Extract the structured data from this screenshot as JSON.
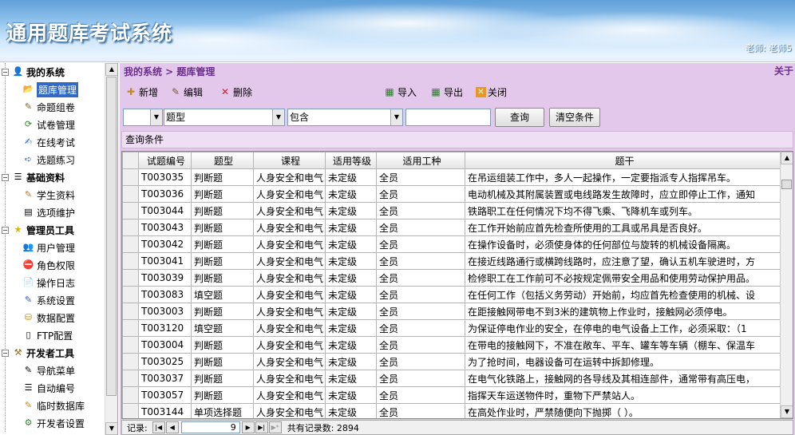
{
  "app": {
    "title": "通用题库考试系统",
    "user_text": "老师: 老师5"
  },
  "sidebar": {
    "groups": [
      {
        "label": "我的系统",
        "items": [
          {
            "label": "题库管理",
            "icon": "folder-open-icon"
          },
          {
            "label": "命题组卷",
            "icon": "pen-icon"
          },
          {
            "label": "试卷管理",
            "icon": "document-refresh-icon"
          },
          {
            "label": "在线考试",
            "icon": "exam-icon"
          },
          {
            "label": "选题练习",
            "icon": "practice-icon"
          }
        ]
      },
      {
        "label": "基础资料",
        "items": [
          {
            "label": "学生资料",
            "icon": "student-icon"
          },
          {
            "label": "选项维护",
            "icon": "list-icon"
          }
        ]
      },
      {
        "label": "管理员工具",
        "items": [
          {
            "label": "用户管理",
            "icon": "users-icon"
          },
          {
            "label": "角色权限",
            "icon": "forbidden-icon"
          },
          {
            "label": "操作日志",
            "icon": "log-icon"
          },
          {
            "label": "系统设置",
            "icon": "settings-icon"
          },
          {
            "label": "数据配置",
            "icon": "database-icon"
          },
          {
            "label": "FTP配置",
            "icon": "ftp-icon"
          }
        ]
      },
      {
        "label": "开发者工具",
        "items": [
          {
            "label": "导航菜单",
            "icon": "menu-icon"
          },
          {
            "label": "自动编号",
            "icon": "numbering-icon"
          },
          {
            "label": "临时数据库",
            "icon": "temp-db-icon"
          },
          {
            "label": "开发者设置",
            "icon": "dev-settings-icon"
          }
        ]
      }
    ],
    "selected": "题库管理"
  },
  "main": {
    "breadcrumb": "我的系统 > 题库管理",
    "about_label": "关于",
    "toolbar": {
      "add": "新增",
      "edit": "编辑",
      "delete": "删除",
      "import": "导入",
      "export": "导出",
      "close": "关闭"
    },
    "filter": {
      "field1_value": "",
      "field2_value": "题型",
      "operator_value": "包含",
      "keyword_value": "",
      "query_button": "查询",
      "clear_button": "清空条件"
    },
    "query_conditions_label": "查询条件",
    "grid": {
      "columns": [
        "试题编号",
        "题型",
        "课程",
        "适用等级",
        "适用工种",
        "题干"
      ],
      "rows": [
        [
          "T003035",
          "判断题",
          "人身安全和电气",
          "未定级",
          "全员",
          "在吊运组装工作中，多人一起操作，一定要指派专人指挥吊车。"
        ],
        [
          "T003036",
          "判断题",
          "人身安全和电气",
          "未定级",
          "全员",
          "电动机械及其附属装置或电线路发生故障时，应立即停止工作，通知"
        ],
        [
          "T003044",
          "判断题",
          "人身安全和电气",
          "未定级",
          "全员",
          "铁路职工在任何情况下均不得飞乘、飞降机车或列车。"
        ],
        [
          "T003043",
          "判断题",
          "人身安全和电气",
          "未定级",
          "全员",
          "在工作开始前应首先检查所使用的工具或吊具是否良好。"
        ],
        [
          "T003042",
          "判断题",
          "人身安全和电气",
          "未定级",
          "全员",
          "在操作设备时，必须使身体的任何部位与旋转的机械设备隔离。"
        ],
        [
          "T003041",
          "判断题",
          "人身安全和电气",
          "未定级",
          "全员",
          "在接近线路通行或横跨线路时，应注意了望，确认五机车驶进时，方"
        ],
        [
          "T003039",
          "判断题",
          "人身安全和电气",
          "未定级",
          "全员",
          "检修职工在工作前可不必按规定佩带安全用品和使用劳动保护用品。"
        ],
        [
          "T003083",
          "填空题",
          "人身安全和电气",
          "未定级",
          "全员",
          "在任何工作（包括义务劳动）开始前，均应首先检查使用的机械、设"
        ],
        [
          "T003003",
          "判断题",
          "人身安全和电气",
          "未定级",
          "全员",
          "在距接触网带电不到3米的建筑物上作业时，接触网必须停电。"
        ],
        [
          "T003120",
          "填空题",
          "人身安全和电气",
          "未定级",
          "全员",
          "为保证停电作业的安全，在停电的电气设备上工作，必须采取：（1"
        ],
        [
          "T003004",
          "判断题",
          "人身安全和电气",
          "未定级",
          "全员",
          "在带电的接触网下，不准在敞车、平车、罐车等车辆（棚车、保温车"
        ],
        [
          "T003025",
          "判断题",
          "人身安全和电气",
          "未定级",
          "全员",
          "为了抢时间，电器设备可在运转中拆卸修理。"
        ],
        [
          "T003037",
          "判断题",
          "人身安全和电气",
          "未定级",
          "全员",
          "在电气化铁路上，接触网的各导线及其相连部件，通常带有高压电，"
        ],
        [
          "T003057",
          "判断题",
          "人身安全和电气",
          "未定级",
          "全员",
          "指挥天车运送物件时，重物下严禁站人。"
        ],
        [
          "T003144",
          "单项选择题",
          "人身安全和电气",
          "未定级",
          "全员",
          "在高处作业时，严禁随便向下抛掷（    ）。"
        ]
      ]
    },
    "navbar": {
      "record_label": "记录:",
      "current_record": "9",
      "total_label": "共有记录数: 2894"
    }
  }
}
